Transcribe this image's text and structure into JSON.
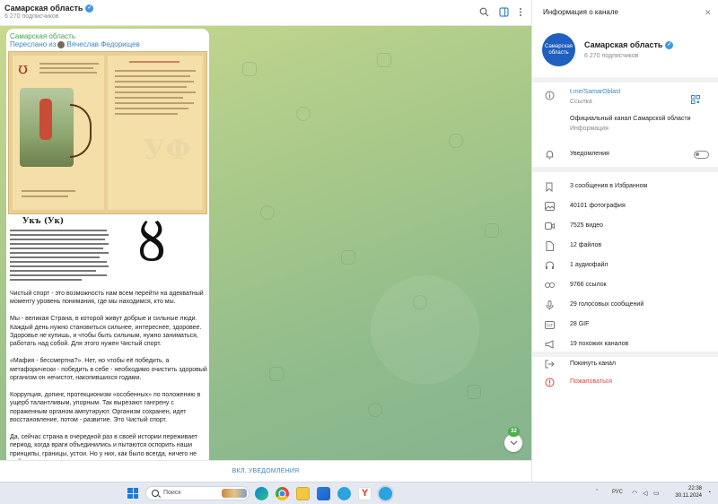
{
  "chat": {
    "title": "Самарская область",
    "subscribers": "6 270 подписчиков",
    "message": {
      "author": "Самарская область",
      "forwarded_from": "Переслано из",
      "forwarded_name": "Вячеслав Федорищев",
      "scan_heading": "Укъ (Ук)",
      "paragraphs": [
        "Чистый спорт - это возможность нам всем перейти на адекватный моменту уровень понимания, где мы находимся, кто мы.",
        "Мы - великая Страна, в которой живут добрые и сильные люди. Каждый день нужно становиться сильнее, интереснее, здоровее. Здоровье не купишь, и чтобы быть сильным, нужно заниматься, работать над собой. Для этого нужен Чистый спорт.",
        "«Мафия - бессмертна?». Нет, но чтобы её победить, а метафорически - победить в себе - необходимо очистить здоровый организм он нечистот, накопившихся годами.",
        "Коррупция, допинг, протекционизм «особенных» по положению в ущерб талантливым, упорным. Так вырезают гангрену с пораженным органом ампутируют. Организм сохранен, идет восстановление, потом - развитие. Это Чистый спорт.",
        "Да, сейчас страна в очередной раз в своей истории переживает период, когда враги объединились и пытаются оспорить наши принципы, границы, устои. Но у них, как было всегда, ничего не выйдет - мы сильные, а наши парни, которые защищают всех"
      ]
    },
    "unread_count": "32",
    "footer_button": "ВКЛ. УВЕДОМЛЕНИЯ"
  },
  "info": {
    "header_title": "Информация о канале",
    "avatar_text": "Самарская область",
    "name": "Самарская область",
    "subscribers": "6 270 подписчиков",
    "link": "t.me/SamarOblast",
    "link_label": "Ссылка",
    "description": "Официальный канал Самарской области",
    "description_label": "Информация",
    "notifications": "Уведомления",
    "stats": [
      {
        "icon": "bookmark-icon",
        "label": "3 сообщения в Избранном"
      },
      {
        "icon": "photo-icon",
        "label": "40101 фотография"
      },
      {
        "icon": "video-icon",
        "label": "7525 видео"
      },
      {
        "icon": "file-icon",
        "label": "12 файлов"
      },
      {
        "icon": "headphones-icon",
        "label": "1 аудиофайл"
      },
      {
        "icon": "link-icon",
        "label": "9766 ссылок"
      },
      {
        "icon": "microphone-icon",
        "label": "29 голосовых сообщений"
      },
      {
        "icon": "gif-icon",
        "label": "28 GIF"
      },
      {
        "icon": "megaphone-icon",
        "label": "19 похожих каналов"
      }
    ],
    "leave": "Покинуть канал",
    "report": "Пожаловаться"
  },
  "taskbar": {
    "search_placeholder": "Поиск",
    "language": "РУС",
    "time": "22:38",
    "date": "30.11.2024"
  },
  "colors": {
    "accent": "#3a86c8",
    "author_green": "#3fa64a",
    "danger": "#e0453a",
    "avatar_blue": "#1e5fbf"
  }
}
